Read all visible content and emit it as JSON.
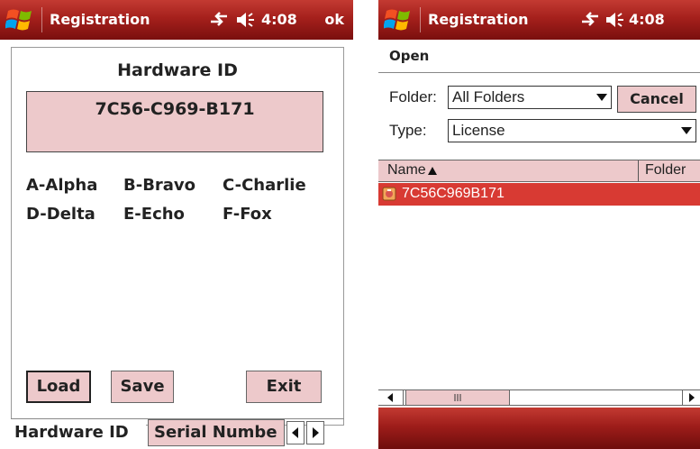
{
  "left": {
    "titlebar": {
      "title": "Registration",
      "time": "4:08",
      "ok": "ok"
    },
    "heading": "Hardware ID",
    "hardware_id": "7C56-C969-B171",
    "phonetics": [
      "A-Alpha",
      "B-Bravo",
      "C-Charlie",
      "D-Delta",
      "E-Echo",
      "F-Fox"
    ],
    "buttons": {
      "load": "Load",
      "save": "Save",
      "exit": "Exit"
    },
    "tabs": {
      "active": "Hardware ID",
      "inactive": "Serial Numbe"
    }
  },
  "right": {
    "titlebar": {
      "title": "Registration",
      "time": "4:08"
    },
    "dialog_title": "Open",
    "folder": {
      "label": "Folder:",
      "value": "All Folders"
    },
    "cancel": "Cancel",
    "type": {
      "label": "Type:",
      "value": "License"
    },
    "columns": {
      "name": "Name",
      "folder": "Folder"
    },
    "files": [
      "7C56C969B171"
    ]
  },
  "colors": {
    "accent_pink": "#edc9cb",
    "title_red": "#a5201c",
    "selection_red": "#d83a33"
  },
  "icons": [
    "windows-start-icon",
    "connectivity-icon",
    "volume-icon",
    "sort-ascending-icon",
    "license-file-icon",
    "scroll-left-icon",
    "scroll-right-icon"
  ]
}
